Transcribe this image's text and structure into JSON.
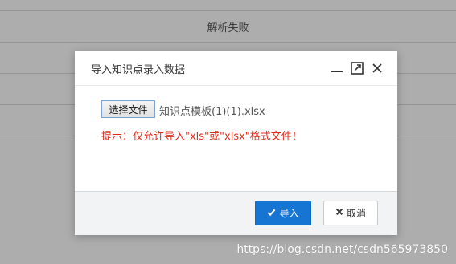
{
  "background": {
    "rows": [
      "",
      "解析失败",
      "",
      "",
      ""
    ]
  },
  "dialog": {
    "title": "导入知识点录入数据",
    "controls": {
      "minimize_icon": "minimize-icon",
      "maximize_icon": "maximize-icon",
      "close_icon": "close-icon"
    },
    "file_input": {
      "button_label": "选择文件",
      "file_name": "知识点模板(1)(1).xlsx"
    },
    "hint": "提示：仅允许导入\"xls\"或\"xlsx\"格式文件！",
    "buttons": {
      "import_label": "导入",
      "cancel_label": "取消"
    }
  },
  "watermark": "https://blog.csdn.net/csdn565973850",
  "colors": {
    "primary": "#1674d3",
    "hint_red": "#e02a1a"
  }
}
